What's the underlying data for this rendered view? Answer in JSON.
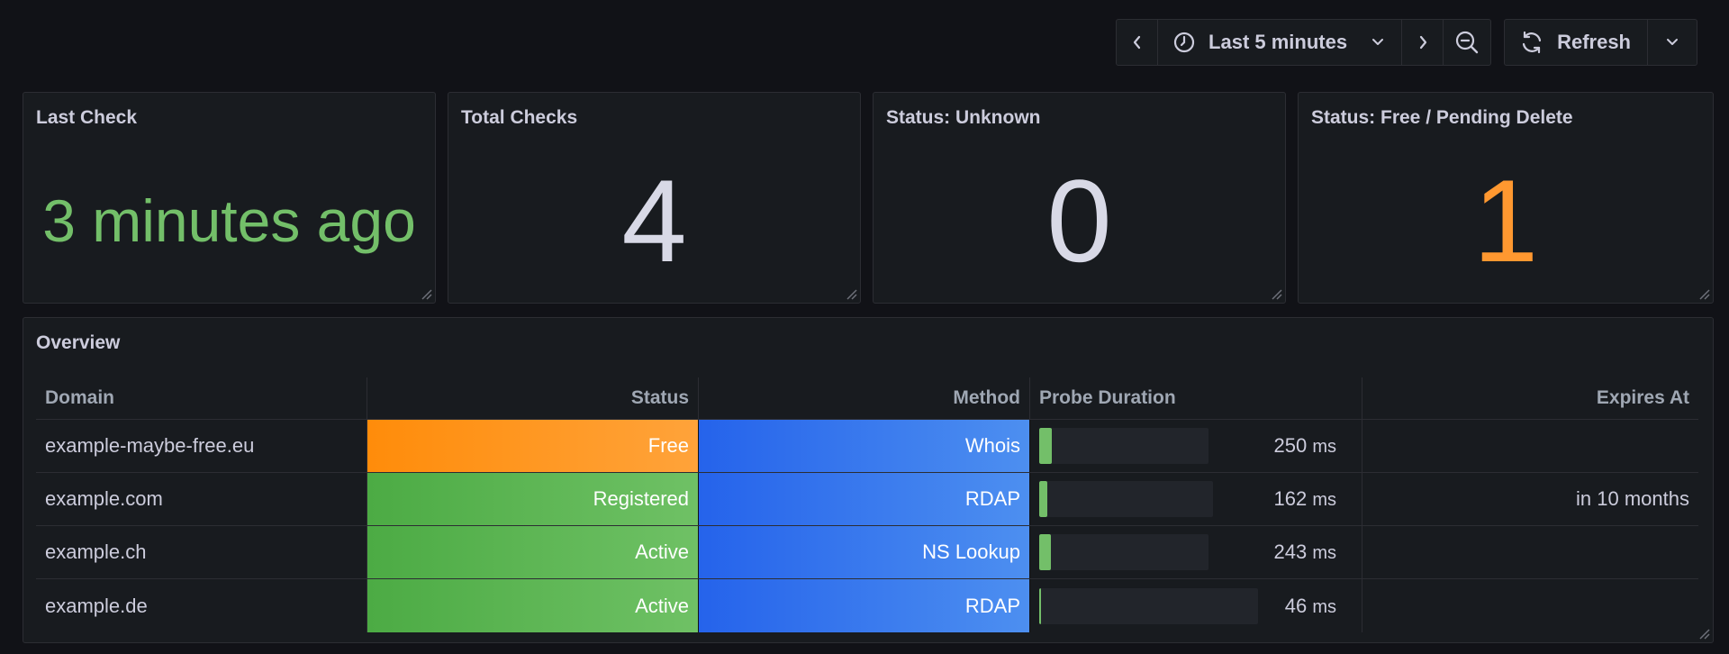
{
  "toolbar": {
    "time_range": "Last 5 minutes",
    "refresh_label": "Refresh"
  },
  "stats": [
    {
      "title": "Last Check",
      "value": "3 minutes ago",
      "color": "#73bf69"
    },
    {
      "title": "Total Checks",
      "value": "4",
      "color": "#d8d9e6"
    },
    {
      "title": "Status: Unknown",
      "value": "0",
      "color": "#d8d9e6"
    },
    {
      "title": "Status: Free / Pending Delete",
      "value": "1",
      "color": "#ff9830"
    }
  ],
  "overview": {
    "title": "Overview",
    "columns": [
      "Domain",
      "Status",
      "Method",
      "Probe Duration",
      "Expires At"
    ],
    "rows": [
      {
        "domain": "example-maybe-free.eu",
        "status": "Free",
        "status_color": "#ff9830",
        "method": "Whois",
        "probe_value": "250",
        "probe_unit": "ms",
        "probe_fraction": 0.074,
        "expires": ""
      },
      {
        "domain": "example.com",
        "status": "Registered",
        "status_color": "#73bf69",
        "method": "RDAP",
        "probe_value": "162",
        "probe_unit": "ms",
        "probe_fraction": 0.045,
        "expires": "in 10 months"
      },
      {
        "domain": "example.ch",
        "status": "Active",
        "status_color": "#73bf69",
        "method": "NS Lookup",
        "probe_value": "243",
        "probe_unit": "ms",
        "probe_fraction": 0.07,
        "expires": ""
      },
      {
        "domain": "example.de",
        "status": "Active",
        "status_color": "#73bf69",
        "method": "RDAP",
        "probe_value": "46",
        "probe_unit": "ms",
        "probe_fraction": 0.008,
        "expires": ""
      }
    ]
  }
}
